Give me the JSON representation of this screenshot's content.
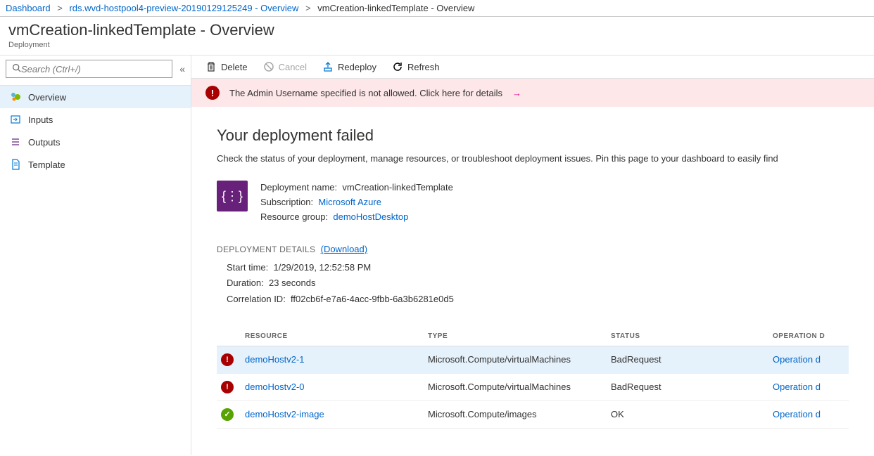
{
  "breadcrumbs": [
    {
      "label": "Dashboard"
    },
    {
      "label": "rds.wvd-hostpool4-preview-20190129125249 - Overview"
    },
    {
      "label": "vmCreation-linkedTemplate - Overview"
    }
  ],
  "header": {
    "title": "vmCreation-linkedTemplate - Overview",
    "subtitle": "Deployment"
  },
  "sidebar": {
    "search_placeholder": "Search (Ctrl+/)",
    "items": [
      {
        "label": "Overview"
      },
      {
        "label": "Inputs"
      },
      {
        "label": "Outputs"
      },
      {
        "label": "Template"
      }
    ]
  },
  "toolbar": {
    "delete": "Delete",
    "cancel": "Cancel",
    "redeploy": "Redeploy",
    "refresh": "Refresh"
  },
  "banner": {
    "text": "The Admin Username specified is not allowed. Click here for details"
  },
  "failure": {
    "title": "Your deployment failed",
    "desc": "Check the status of your deployment, manage resources, or troubleshoot deployment issues. Pin this page to your dashboard to easily find"
  },
  "deploy": {
    "name_label": "Deployment name:",
    "name_value": "vmCreation-linkedTemplate",
    "sub_label": "Subscription:",
    "sub_value": "Microsoft Azure",
    "rg_label": "Resource group:",
    "rg_value": "demoHostDesktop"
  },
  "details": {
    "header": "DEPLOYMENT DETAILS",
    "download": "(Download)",
    "start_label": "Start time:",
    "start_value": "1/29/2019, 12:52:58 PM",
    "duration_label": "Duration:",
    "duration_value": "23 seconds",
    "corr_label": "Correlation ID:",
    "corr_value": "ff02cb6f-e7a6-4acc-9fbb-6a3b6281e0d5"
  },
  "table": {
    "col_resource": "RESOURCE",
    "col_type": "TYPE",
    "col_status": "STATUS",
    "col_op": "OPERATION D",
    "rows": [
      {
        "status": "err",
        "name": "demoHostv2-1",
        "type": "Microsoft.Compute/virtualMachines",
        "status_text": "BadRequest",
        "op": "Operation d"
      },
      {
        "status": "err",
        "name": "demoHostv2-0",
        "type": "Microsoft.Compute/virtualMachines",
        "status_text": "BadRequest",
        "op": "Operation d"
      },
      {
        "status": "ok",
        "name": "demoHostv2-image",
        "type": "Microsoft.Compute/images",
        "status_text": "OK",
        "op": "Operation d"
      }
    ]
  }
}
